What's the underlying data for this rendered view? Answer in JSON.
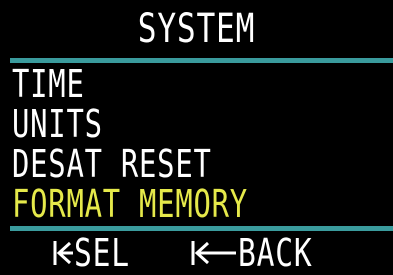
{
  "header": {
    "title": "SYSTEM"
  },
  "menu": {
    "items": [
      {
        "label": "TIME",
        "selected": false
      },
      {
        "label": "UNITS",
        "selected": false
      },
      {
        "label": "DESAT RESET",
        "selected": false
      },
      {
        "label": "FORMAT MEMORY",
        "selected": true
      }
    ]
  },
  "footer": {
    "left_key": {
      "icon": "button-short-press-icon",
      "label": "SEL"
    },
    "right_key": {
      "icon": "button-long-press-icon",
      "label": "BACK"
    }
  },
  "colors": {
    "background": "#000000",
    "text": "#ffffff",
    "selected_text": "#e5e94a",
    "divider": "#3a9b9d"
  }
}
